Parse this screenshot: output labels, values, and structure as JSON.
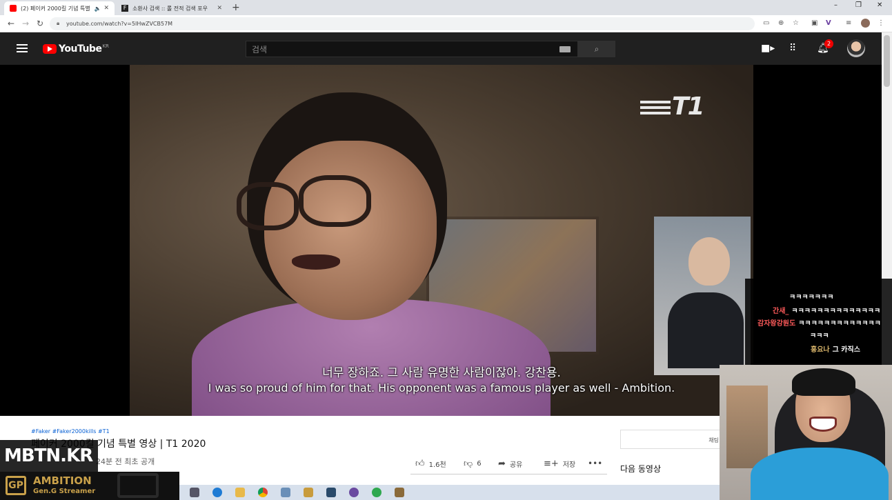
{
  "browser": {
    "tabs": [
      {
        "title": "(2) 페이커 2000킬 기념 특별",
        "active": true,
        "audio_icon": "🔈"
      },
      {
        "title": "소환사 검색 :: 롤 전적 검색 포우",
        "active": false
      }
    ],
    "new_tab": "+",
    "window_controls": {
      "minimize": "–",
      "restore": "❐",
      "close": "✕"
    },
    "url": "youtube.com/watch?v=5IHwZVCB57M"
  },
  "youtube": {
    "logo_text": "YouTube",
    "logo_region": "KR",
    "search_placeholder": "검색",
    "notification_count": "2"
  },
  "video": {
    "brand_logo": "T1",
    "subtitle_ko": "너무 장하죠. 그 사람 유명한 사람이잖아. 강찬용.",
    "subtitle_en": "I was so proud of him for that. His opponent was a famous player as well - Ambition.",
    "hashtags": "#Faker #Faker2000kills #T1",
    "title": "페이커 2000킬 기념 특별 영상 | T1 2020",
    "meta": "· 24분 전 최초 공개",
    "likes": "1.6천",
    "dislikes": "6",
    "share_label": "공유",
    "save_label": "저장",
    "more_label": "•••"
  },
  "sidebar": {
    "chat_label": "채팅",
    "next_label": "다음 동영상"
  },
  "chat": [
    {
      "nick": "",
      "msg": "ㅋㅋㅋㅋㅋㅋㅋ"
    },
    {
      "nick": "간새_",
      "msg": "ㅋㅋㅋㅋㅋㅋㅋㅋㅋㅋㅋㅋㅋㅋ"
    },
    {
      "nick": "감자왕강원도",
      "msg": "ㅋㅋㅋㅋㅋㅋㅋㅋㅋㅋㅋㅋㅋ"
    },
    {
      "nick": "",
      "msg": "ㅋㅋㅋ"
    },
    {
      "nick": "홍요나",
      "msg": "그 카직스"
    }
  ],
  "overlay": {
    "site": "MBTN.KR",
    "streamer_name": "AMBITION",
    "streamer_sub": "Gen.G Streamer",
    "logo_text": "GP"
  },
  "colors": {
    "yt_header": "#202020",
    "yt_red": "#ff0000",
    "chat_nick_red": "#ff5a5a",
    "chat_nick_gold": "#d8b46a",
    "geng_gold": "#c9a14a",
    "link_blue": "#065fd4"
  }
}
